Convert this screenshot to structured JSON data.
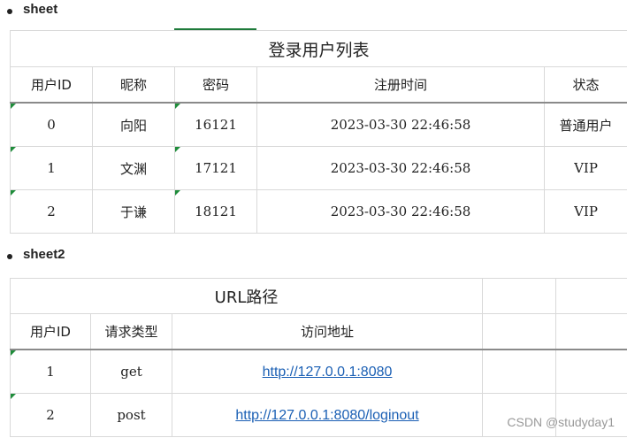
{
  "sheet1": {
    "heading": "sheet",
    "title": "登录用户列表",
    "headers": [
      "用户ID",
      "昵称",
      "密码",
      "注册时间",
      "状态"
    ],
    "rows": [
      [
        "0",
        "向阳",
        "16121",
        "2023-03-30 22:46:58",
        "普通用户"
      ],
      [
        "1",
        "文渊",
        "17121",
        "2023-03-30 22:46:58",
        "VIP"
      ],
      [
        "2",
        "于谦",
        "18121",
        "2023-03-30 22:46:58",
        "VIP"
      ]
    ]
  },
  "sheet2": {
    "heading": "sheet2",
    "title": "URL路径",
    "headers": [
      "用户ID",
      "请求类型",
      "访问地址"
    ],
    "rows": [
      [
        "1",
        "get",
        "http://127.0.0.1:8080"
      ],
      [
        "2",
        "post",
        "http://127.0.0.1:8080/loginout"
      ]
    ]
  },
  "watermark": "CSDN @studyday1",
  "colors": {
    "marker": "#1e8c3a",
    "link": "#1a5fb4"
  }
}
